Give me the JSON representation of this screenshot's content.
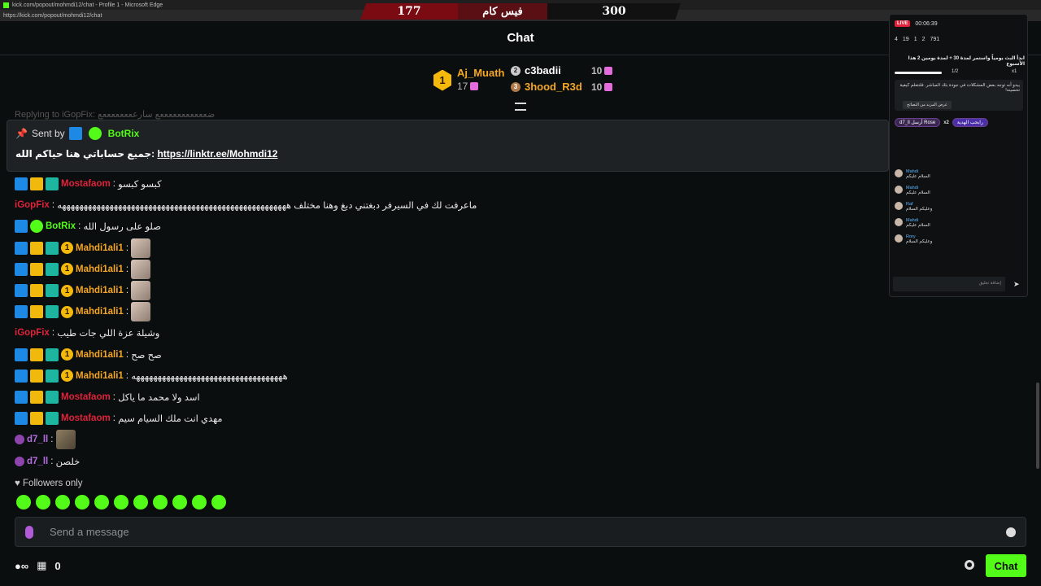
{
  "window": {
    "title": "kick.com/popout/mohmdi12/chat - Profile 1 - Microsoft Edge",
    "url": "https://kick.com/popout/mohmdi12/chat"
  },
  "scoreboard": {
    "left_score": "177",
    "center_label": "فيس كام",
    "right_score": "300"
  },
  "header": {
    "title": "Chat"
  },
  "gifters": [
    {
      "rank": "1",
      "name": "Aj_Muath",
      "count": "17"
    },
    {
      "rank": "2",
      "name": "c3badii",
      "count": "10"
    },
    {
      "rank": "3",
      "name": "3hood_R3d",
      "count": "10"
    }
  ],
  "reply_preview": "Replying to iGopFix: ضعععععععععععع سارععععععععع",
  "pinned": {
    "sent_by_label": "Sent by",
    "sender": "BotRix",
    "message": "جميع حساباتي هنا حياكم الله:",
    "link": "https://linktr.ee/Mohmdi12"
  },
  "messages": [
    {
      "user": "Mostafaom",
      "text": "كبسو كبسو"
    },
    {
      "user": "iGopFix",
      "text": "ماعرفت لك في السيرفر دبغتني دبغ وهنا مختلف هههههههههههههههههههههههههههههههههههههههههههههههههههههه"
    },
    {
      "user": "BotRix",
      "text": "صلو على رسول الله"
    },
    {
      "user": "Mahdi1ali1",
      "text": ""
    },
    {
      "user": "Mahdi1ali1",
      "text": ""
    },
    {
      "user": "Mahdi1ali1",
      "text": ""
    },
    {
      "user": "Mahdi1ali1",
      "text": ""
    },
    {
      "user": "iGopFix",
      "text": "وشيلة عزة اللي جات طيب"
    },
    {
      "user": "Mahdi1ali1",
      "text": "صح صح"
    },
    {
      "user": "Mahdi1ali1",
      "text": "هههههههههههههههههههههههههههههههههههه"
    },
    {
      "user": "Mostafaom",
      "text": "اسد ولا محمد ما ياكل"
    },
    {
      "user": "Mostafaom",
      "text": "مهدي انت ملك السيام سيم"
    },
    {
      "user": "d7_ll",
      "text": ""
    },
    {
      "user": "d7_ll",
      "text": "خلصن"
    }
  ],
  "followers_only": "Followers only",
  "input": {
    "placeholder": "Send a message"
  },
  "bottom": {
    "points": "0",
    "chat_button": "Chat"
  },
  "overlay": {
    "live": "LIVE",
    "time": "00:06:39",
    "stats": [
      "4",
      "19",
      "1",
      "2",
      "791"
    ],
    "title": "ابدأ البث يومياً واستمر لمدة 30 + لمدة يومين 2 هذا الأسبوع",
    "progress": "1/2",
    "multiplier": "x1",
    "alert": "يبدو أنه توجد بعض المشكلات في جودة بثك المباشر. فلنتعلم كيفية تحسينه!",
    "alert_more": "عرض المزيد من النصائح",
    "gift_user": "d7_ll",
    "gift_label": "أرسل Rose",
    "gift_count": "x2",
    "gift_tag": "رابحب الهدية",
    "chat": [
      {
        "name": "Mahdi",
        "text": "السلام عليكم"
      },
      {
        "name": "Mahdi",
        "text": "السلام عليكم"
      },
      {
        "name": "Raf",
        "text": "وعليكم السلام"
      },
      {
        "name": "Mahdi",
        "text": "السلام عليكم"
      },
      {
        "name": "Rory",
        "text": "وعليكم السلام"
      }
    ],
    "input_placeholder": "إضافة تعليق"
  }
}
